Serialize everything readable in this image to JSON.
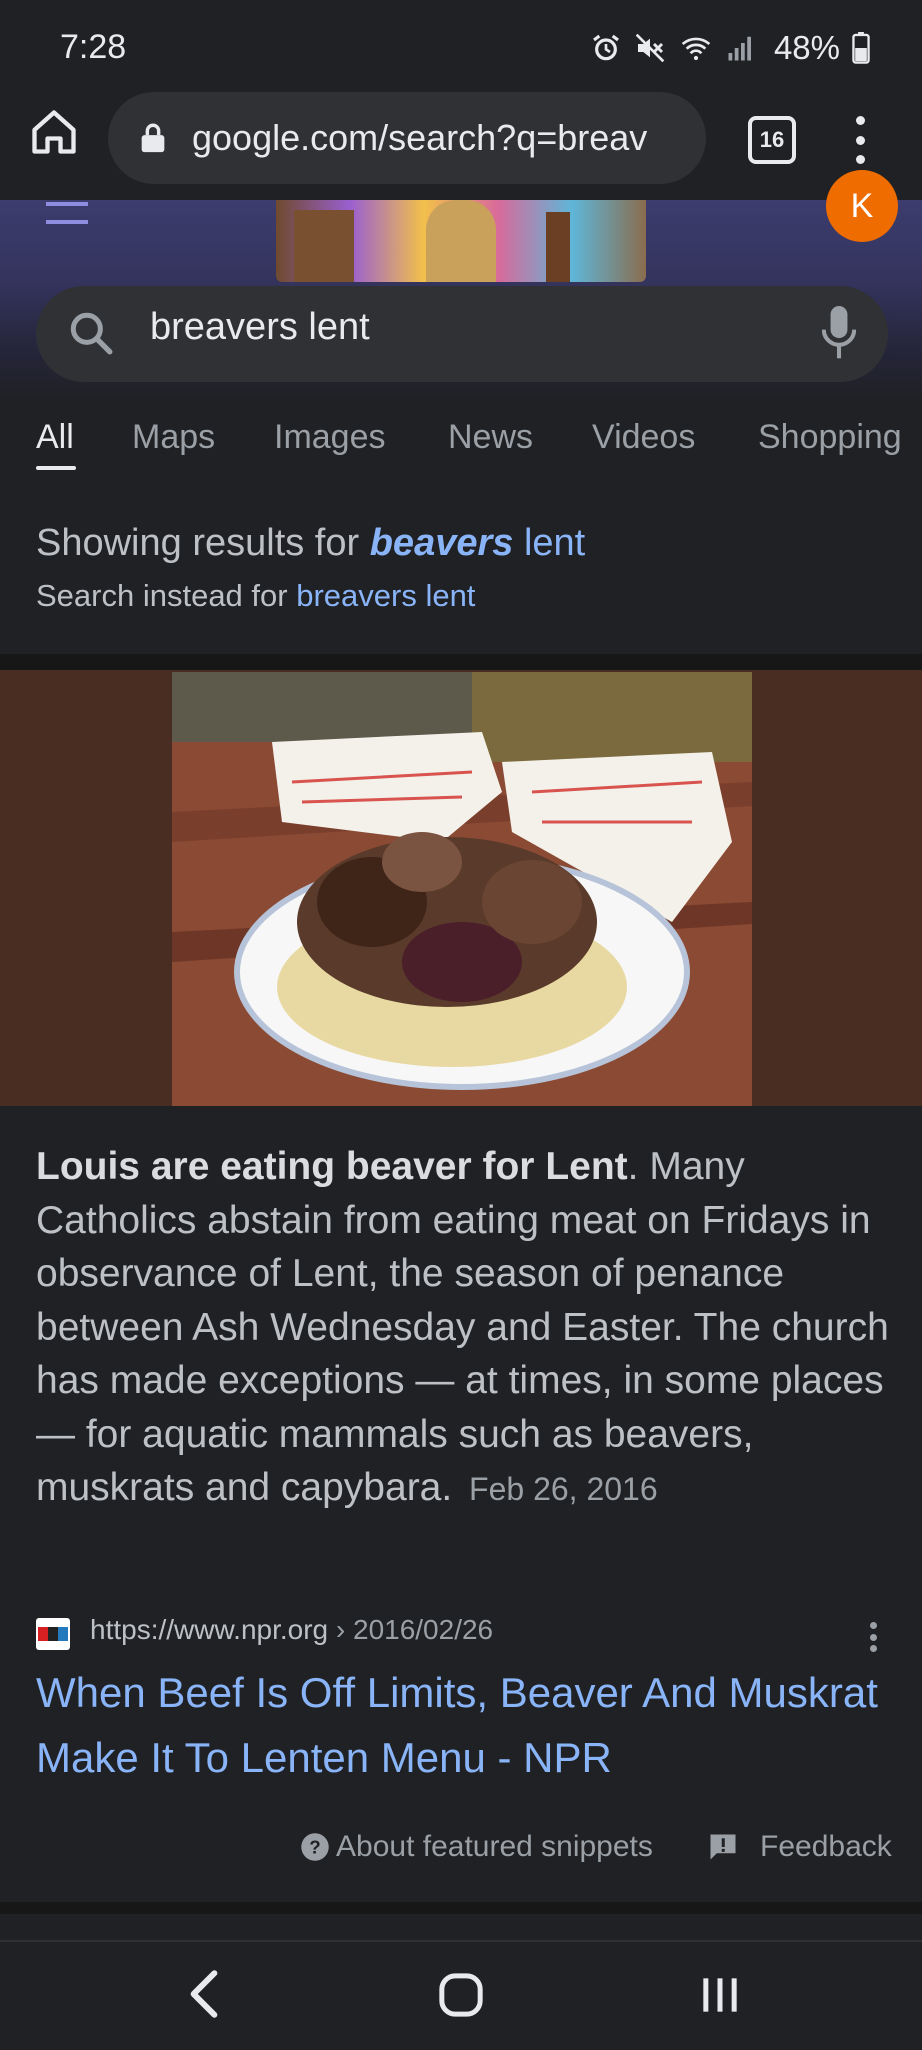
{
  "status": {
    "time": "7:28",
    "battery": "48%"
  },
  "browser": {
    "url": "google.com/search?q=breav",
    "tab_count": "16"
  },
  "google": {
    "avatar_letter": "K",
    "query": "breavers lent",
    "tabs": [
      "All",
      "Maps",
      "Images",
      "News",
      "Videos",
      "Shopping"
    ],
    "active_tab": "All"
  },
  "spelling": {
    "prefix": "Showing results for",
    "corrected_bold": "beavers",
    "corrected_rest": "lent",
    "instead_prefix": "Search instead for",
    "instead_link": "breavers lent"
  },
  "snippet": {
    "bold": "Louis are eating beaver for Lent",
    "text": ". Many Catholics abstain from eating meat on Fridays in observance of Lent, the season of penance between Ash Wednesday and Easter. The church has made exceptions — at times, in some places — for aquatic mammals such as beavers, muskrats and capybara.",
    "date": "Feb 26, 2016"
  },
  "result": {
    "favicon_text": "npr",
    "url": "https://www.npr.org",
    "breadcrumb": " › 2016/02/26",
    "title": "When Beef Is Off Limits, Beaver And Muskrat Make It To Lenten Menu - NPR"
  },
  "footer": {
    "about": "About featured snippets",
    "feedback": "Feedback"
  },
  "colors": {
    "link": "#8ab4f8",
    "avatar": "#ef6c00",
    "background": "#202124"
  }
}
